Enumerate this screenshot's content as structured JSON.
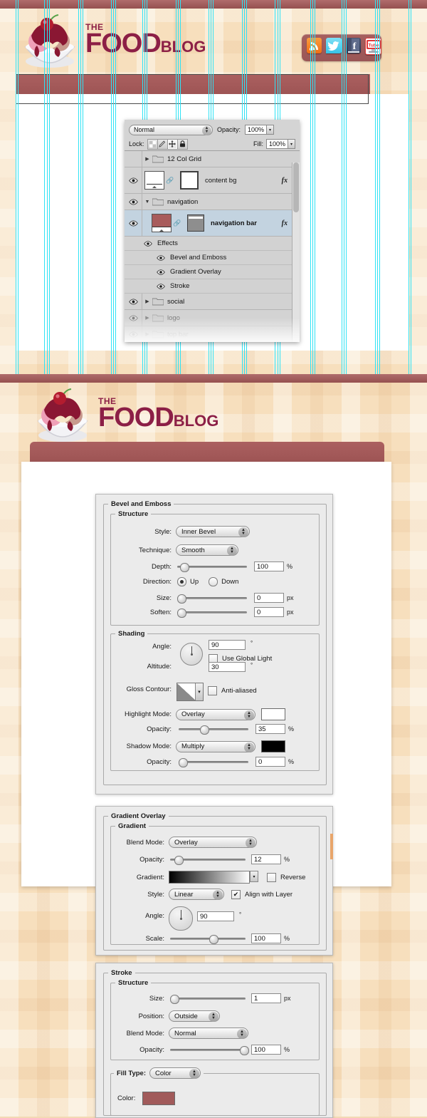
{
  "site": {
    "brand_pre": "THE",
    "brand_main": "FOOD",
    "brand_sub": "BLOG",
    "brand_color": "#8c1f46",
    "navbar_color": "#a55b5b",
    "background_color": "#f7dfbd",
    "social": [
      {
        "name": "rss-icon",
        "label": "RSS",
        "color": "#ef6e15"
      },
      {
        "name": "twitter-icon",
        "label": "Twitter",
        "color": "#37c3e8"
      },
      {
        "name": "facebook-icon",
        "label": "Facebook",
        "color": "#2b3550"
      },
      {
        "name": "youtube-icon",
        "label": "YouTube",
        "color": "#e23b3b"
      }
    ]
  },
  "layers_panel": {
    "blend_mode": "Normal",
    "opacity_label": "Opacity:",
    "opacity_value": "100%",
    "lock_label": "Lock:",
    "fill_label": "Fill:",
    "fill_value": "100%",
    "lock_buttons": [
      {
        "name": "lock-transparent-pixels",
        "glyph": "▨"
      },
      {
        "name": "lock-image-pixels",
        "glyph": "✎"
      },
      {
        "name": "lock-position",
        "glyph": "✛"
      },
      {
        "name": "lock-all",
        "glyph": "🔒"
      }
    ],
    "rows": [
      {
        "name": "12 Col Grid",
        "type": "group",
        "visible": false,
        "expanded": false,
        "selected": false,
        "dim": false
      },
      {
        "name": "content bg",
        "type": "layer",
        "visible": true,
        "fx": true,
        "selected": false,
        "dim": false
      },
      {
        "name": "navigation",
        "type": "group",
        "visible": true,
        "expanded": true,
        "selected": false,
        "dim": false
      },
      {
        "name": "navigation bar",
        "type": "layer",
        "visible": true,
        "fx": true,
        "selected": true,
        "dim": false
      },
      {
        "name": "Effects",
        "type": "effects-header",
        "visible": true
      },
      {
        "name": "Bevel and Emboss",
        "type": "effect",
        "visible": true
      },
      {
        "name": "Gradient Overlay",
        "type": "effect",
        "visible": true
      },
      {
        "name": "Stroke",
        "type": "effect",
        "visible": true
      },
      {
        "name": "social",
        "type": "group",
        "visible": true,
        "expanded": false,
        "selected": false,
        "dim": false
      },
      {
        "name": "logo",
        "type": "group",
        "visible": true,
        "expanded": false,
        "selected": false,
        "dim": true
      },
      {
        "name": "top bar",
        "type": "group",
        "visible": true,
        "expanded": false,
        "selected": false,
        "dim": true
      }
    ]
  },
  "bevel": {
    "title": "Bevel and Emboss",
    "structure_title": "Structure",
    "style_label": "Style:",
    "style_value": "Inner Bevel",
    "technique_label": "Technique:",
    "technique_value": "Smooth",
    "depth_label": "Depth:",
    "depth_value": "100",
    "depth_unit": "%",
    "direction_label": "Direction:",
    "direction_up": "Up",
    "direction_down": "Down",
    "direction_selected": "Up",
    "size_label": "Size:",
    "size_value": "0",
    "size_unit": "px",
    "soften_label": "Soften:",
    "soften_value": "0",
    "soften_unit": "px",
    "shading_title": "Shading",
    "angle_label": "Angle:",
    "angle_value": "90",
    "angle_unit": "°",
    "global_light_label": "Use Global Light",
    "global_light_checked": false,
    "altitude_label": "Altitude:",
    "altitude_value": "30",
    "altitude_unit": "°",
    "gloss_label": "Gloss Contour:",
    "antialiased_label": "Anti-aliased",
    "antialiased_checked": false,
    "highlight_mode_label": "Highlight Mode:",
    "highlight_mode_value": "Overlay",
    "highlight_color": "#ffffff",
    "highlight_opacity_label": "Opacity:",
    "highlight_opacity_value": "35",
    "highlight_opacity_unit": "%",
    "shadow_mode_label": "Shadow Mode:",
    "shadow_mode_value": "Multiply",
    "shadow_color": "#000000",
    "shadow_opacity_label": "Opacity:",
    "shadow_opacity_value": "0",
    "shadow_opacity_unit": "%"
  },
  "gradient": {
    "title": "Gradient Overlay",
    "group_title": "Gradient",
    "blend_mode_label": "Blend Mode:",
    "blend_mode_value": "Overlay",
    "opacity_label": "Opacity:",
    "opacity_value": "12",
    "opacity_unit": "%",
    "gradient_label": "Gradient:",
    "reverse_label": "Reverse",
    "reverse_checked": false,
    "style_label": "Style:",
    "style_value": "Linear",
    "align_label": "Align with Layer",
    "align_checked": true,
    "angle_label": "Angle:",
    "angle_value": "90",
    "angle_unit": "°",
    "scale_label": "Scale:",
    "scale_value": "100",
    "scale_unit": "%"
  },
  "stroke": {
    "title": "Stroke",
    "structure_title": "Structure",
    "size_label": "Size:",
    "size_value": "1",
    "size_unit": "px",
    "position_label": "Position:",
    "position_value": "Outside",
    "blend_mode_label": "Blend Mode:",
    "blend_mode_value": "Normal",
    "opacity_label": "Opacity:",
    "opacity_value": "100",
    "opacity_unit": "%",
    "fill_type_label": "Fill Type:",
    "fill_type_value": "Color",
    "color_label": "Color:",
    "color_value": "#a15a5a"
  }
}
